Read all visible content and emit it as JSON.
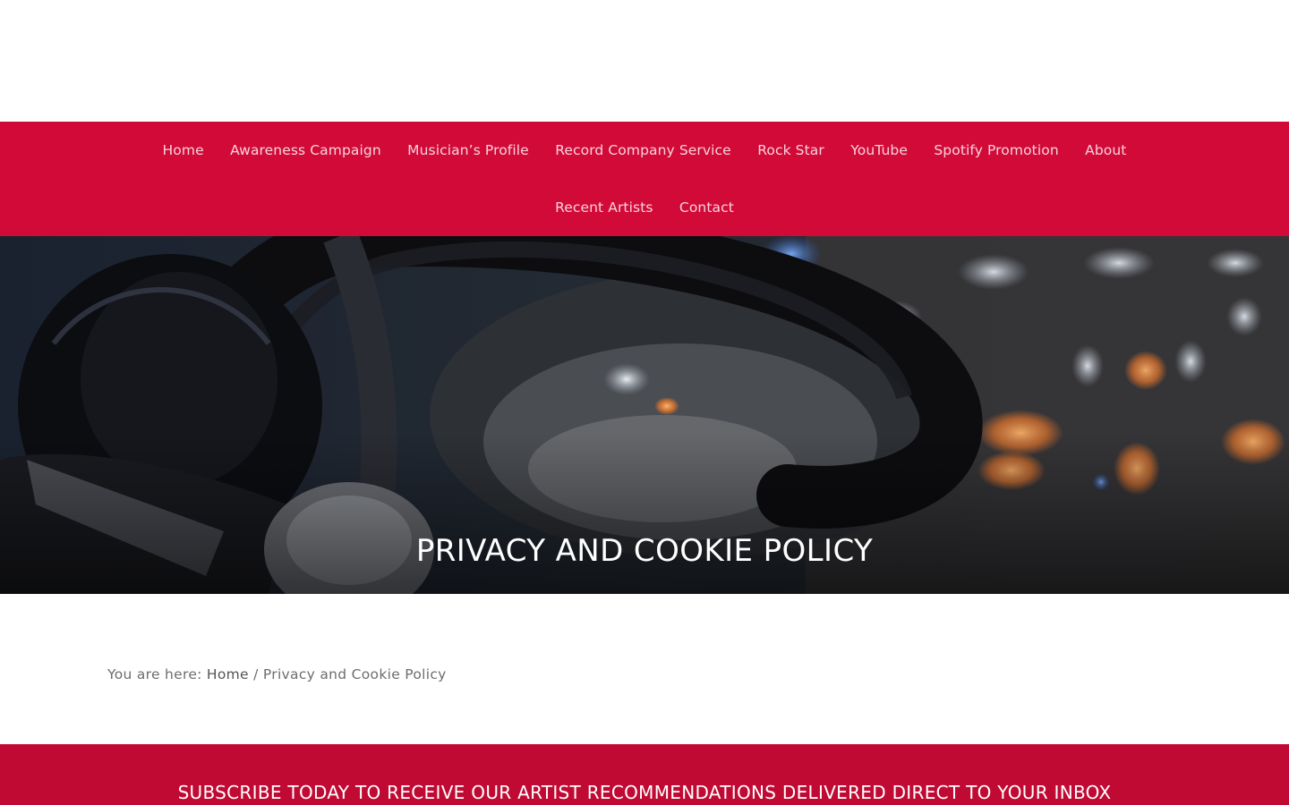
{
  "nav": {
    "items": [
      {
        "label": "Home"
      },
      {
        "label": "Awareness Campaign"
      },
      {
        "label": "Musician’s Profile"
      },
      {
        "label": "Record Company Service"
      },
      {
        "label": "Rock Star"
      },
      {
        "label": "YouTube"
      },
      {
        "label": "Spotify Promotion"
      },
      {
        "label": "About"
      },
      {
        "label": "Recent Artists"
      },
      {
        "label": "Contact"
      }
    ]
  },
  "hero": {
    "title": "PRIVACY AND COOKIE POLICY",
    "image": "headphones-on-dj-mixer-photo"
  },
  "breadcrumb": {
    "prefix": "You are here: ",
    "home": "Home",
    "separator": " / ",
    "current": "Privacy and Cookie Policy"
  },
  "subscribe": {
    "heading": "SUBSCRIBE TODAY TO RECEIVE OUR ARTIST RECOMMENDATIONS DELIVERED DIRECT TO YOUR INBOX"
  },
  "colors": {
    "nav_background": "#d20a38",
    "nav_text": "#f6d3dc",
    "subscribe_background": "#c00a34"
  }
}
